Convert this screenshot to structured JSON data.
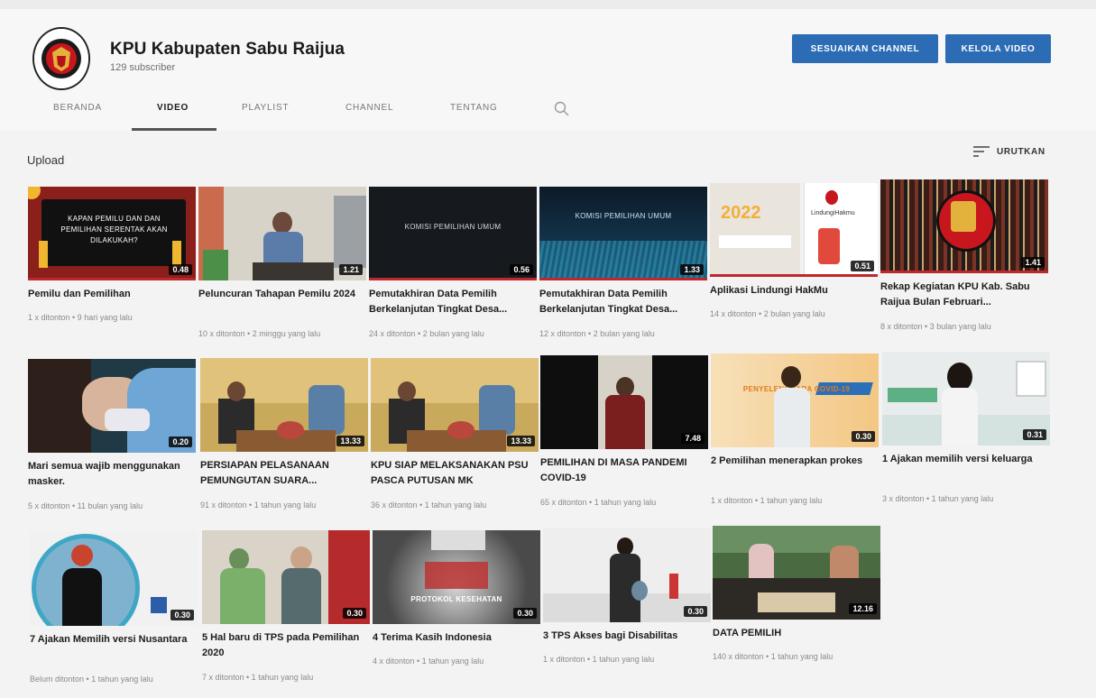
{
  "channel": {
    "name": "KPU Kabupaten Sabu Raijua",
    "subscribers": "129 subscriber",
    "customize_label": "SESUAIKAN CHANNEL",
    "manage_label": "KELOLA VIDEO"
  },
  "tabs": [
    "BERANDA",
    "VIDEO",
    "PLAYLIST",
    "CHANNEL",
    "TENTANG"
  ],
  "active_tab": "VIDEO",
  "section": {
    "title": "Upload",
    "sort_label": "URUTKAN"
  },
  "videos": [
    {
      "title": "Pemilu dan Pemilihan",
      "meta": "1 x ditonton • 9 hari yang lalu",
      "duration": "0.48"
    },
    {
      "title": "Peluncuran Tahapan Pemilu 2024",
      "meta": "10 x ditonton • 2 minggu yang lalu",
      "duration": "1.21"
    },
    {
      "title": "Pemutakhiran Data Pemilih Berkelanjutan Tingkat Desa...",
      "meta": "24 x ditonton • 2 bulan yang lalu",
      "duration": "0.56"
    },
    {
      "title": "Pemutakhiran Data Pemilih Berkelanjutan Tingkat Desa...",
      "meta": "12 x ditonton • 2 bulan yang lalu",
      "duration": "1.33"
    },
    {
      "title": "Aplikasi Lindungi HakMu",
      "meta": "14 x ditonton • 2 bulan yang lalu",
      "duration": "0.51"
    },
    {
      "title": "Rekap Kegiatan KPU Kab. Sabu Raijua Bulan Februari...",
      "meta": "8 x ditonton • 3 bulan yang lalu",
      "duration": "1.41"
    },
    {
      "title": "Mari semua wajib menggunakan masker.",
      "meta": "5 x ditonton • 11 bulan yang lalu",
      "duration": "0.20"
    },
    {
      "title": "PERSIAPAN PELASANAAN PEMUNGUTAN SUARA...",
      "meta": "91 x ditonton • 1 tahun yang lalu",
      "duration": "13.33"
    },
    {
      "title": "KPU SIAP MELAKSANAKAN PSU PASCA PUTUSAN MK",
      "meta": "36 x ditonton • 1 tahun yang lalu",
      "duration": "13.33"
    },
    {
      "title": "PEMILIHAN DI MASA PANDEMI COVID-19",
      "meta": "65 x ditonton • 1 tahun yang lalu",
      "duration": "7.48"
    },
    {
      "title": "2 Pemilihan menerapkan prokes",
      "meta": "1 x ditonton • 1 tahun yang lalu",
      "duration": "0.30"
    },
    {
      "title": "1 Ajakan memilih versi keluarga",
      "meta": "3 x ditonton • 1 tahun yang lalu",
      "duration": "0.31"
    },
    {
      "title": "7 Ajakan Memilih versi Nusantara",
      "meta": "Belum ditonton • 1 tahun yang lalu",
      "duration": "0.30"
    },
    {
      "title": "5 Hal baru di TPS pada Pemilihan 2020",
      "meta": "7 x ditonton • 1 tahun yang lalu",
      "duration": "0.30"
    },
    {
      "title": "4 Terima Kasih Indonesia",
      "meta": "4 x ditonton • 1 tahun yang lalu",
      "duration": "0.30"
    },
    {
      "title": "3 TPS Akses bagi Disabilitas",
      "meta": "1 x ditonton • 1 tahun yang lalu",
      "duration": "0.30"
    },
    {
      "title": "DATA PEMILIH",
      "meta": "140 x ditonton • 1 tahun yang lalu",
      "duration": "12.16"
    }
  ],
  "thumb_text": {
    "v1": "KAPAN PEMILU DAN DAN PEMILIHAN SERENTAK AKAN DILAKUKAH?",
    "v3": "KOMISI PEMILIHAN UMUM",
    "v5": "LindungiHakmu",
    "v11": "PENYELENGGARA COVID-19",
    "v15": "PROTOKOL KESEHATAN"
  },
  "colors": {
    "button": "#2b6cb4",
    "progress": "#c0272d"
  }
}
